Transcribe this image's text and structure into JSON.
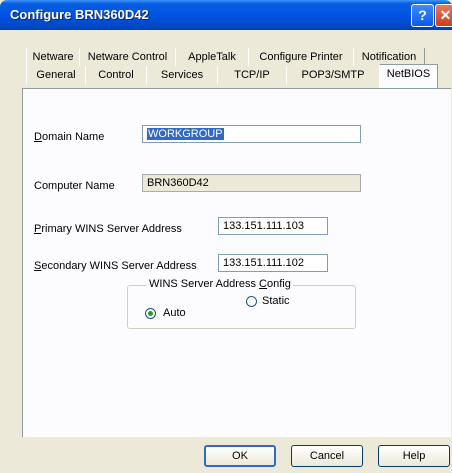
{
  "window": {
    "title": "Configure BRN360D42",
    "help_glyph": "?",
    "close_glyph": "✕"
  },
  "tabs_back": [
    "Netware",
    "Netware Control",
    "AppleTalk",
    "Configure Printer",
    "Notification"
  ],
  "tabs_front": [
    "General",
    "Control",
    "Services",
    "TCP/IP",
    "POP3/SMTP",
    "NetBIOS"
  ],
  "active_tab": "NetBIOS",
  "form": {
    "domain_name": {
      "label_first": "D",
      "label_rest": "omain Name",
      "value": "WORKGROUP"
    },
    "computer_name": {
      "label": "Computer Name",
      "value": "BRN360D42"
    },
    "primary_wins": {
      "label_first": "P",
      "label_rest": "rimary WINS Server Address",
      "value": "133.151.111.103"
    },
    "secondary_wins": {
      "label_first": "S",
      "label_rest": "econdary WINS Server Address",
      "value": "133.151.111.102"
    }
  },
  "wins_config": {
    "label_pre": "WINS Server Address ",
    "label_ul": "C",
    "label_post": "onfig",
    "options": [
      {
        "label": "Auto",
        "selected": true
      },
      {
        "label": "Static",
        "selected": false
      }
    ]
  },
  "buttons": {
    "ok": "OK",
    "cancel": "Cancel",
    "help": "Help"
  }
}
